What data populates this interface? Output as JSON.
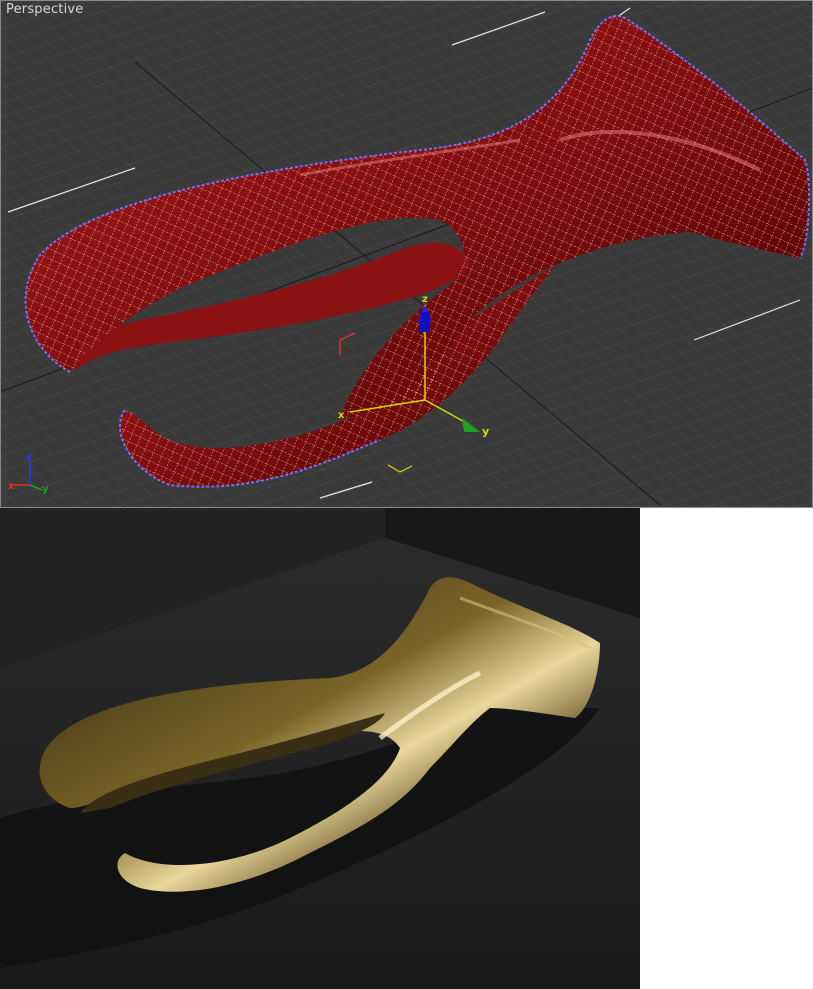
{
  "viewport": {
    "label": "Perspective",
    "background_color": "#3a3a3a",
    "grid_color": "#4a4a4a",
    "mesh_fill_color": "#8a1010",
    "wire_color": "#ffffff",
    "edge_color": "#6a6aff",
    "gizmo": {
      "x_label": "x",
      "y_label": "y",
      "z_label": "z"
    },
    "axis_tripod": {
      "x_label": "x",
      "y_label": "y",
      "z_label": "z"
    }
  },
  "render": {
    "background_color": "#1c1c1c",
    "material_color": "#6b5a2a",
    "highlight_color": "#f6e7b8"
  }
}
